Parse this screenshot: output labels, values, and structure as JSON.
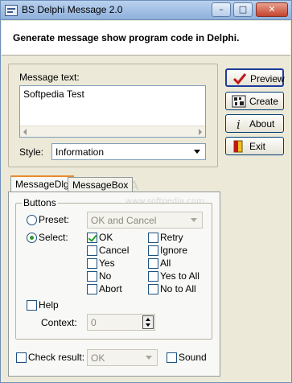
{
  "window": {
    "title": "BS Delphi Message 2.0"
  },
  "header": {
    "text": "Generate message show program code in Delphi."
  },
  "message": {
    "label": "Message text:",
    "value": "Softpedia Test",
    "style_label": "Style:",
    "style_value": "Information"
  },
  "buttons": {
    "preview": "Preview",
    "create": "Create",
    "about": "About",
    "exit": "Exit"
  },
  "tabs": [
    {
      "label": "MessageDlg",
      "active": true
    },
    {
      "label": "MessageBox",
      "active": false
    }
  ],
  "buttons_group": {
    "title": "Buttons",
    "preset_label": "Preset:",
    "preset_value": "OK and Cancel",
    "select_label": "Select:",
    "checkboxes_col1": [
      "OK",
      "Cancel",
      "Yes",
      "No",
      "Abort"
    ],
    "checkboxes_col2": [
      "Retry",
      "Ignore",
      "All",
      "Yes to All",
      "No to All"
    ]
  },
  "help": {
    "label": "Help",
    "context_label": "Context:",
    "context_value": "0"
  },
  "result": {
    "check_label": "Check result:",
    "check_value": "OK",
    "sound_label": "Sound"
  },
  "watermark": "www.softpedia.com"
}
